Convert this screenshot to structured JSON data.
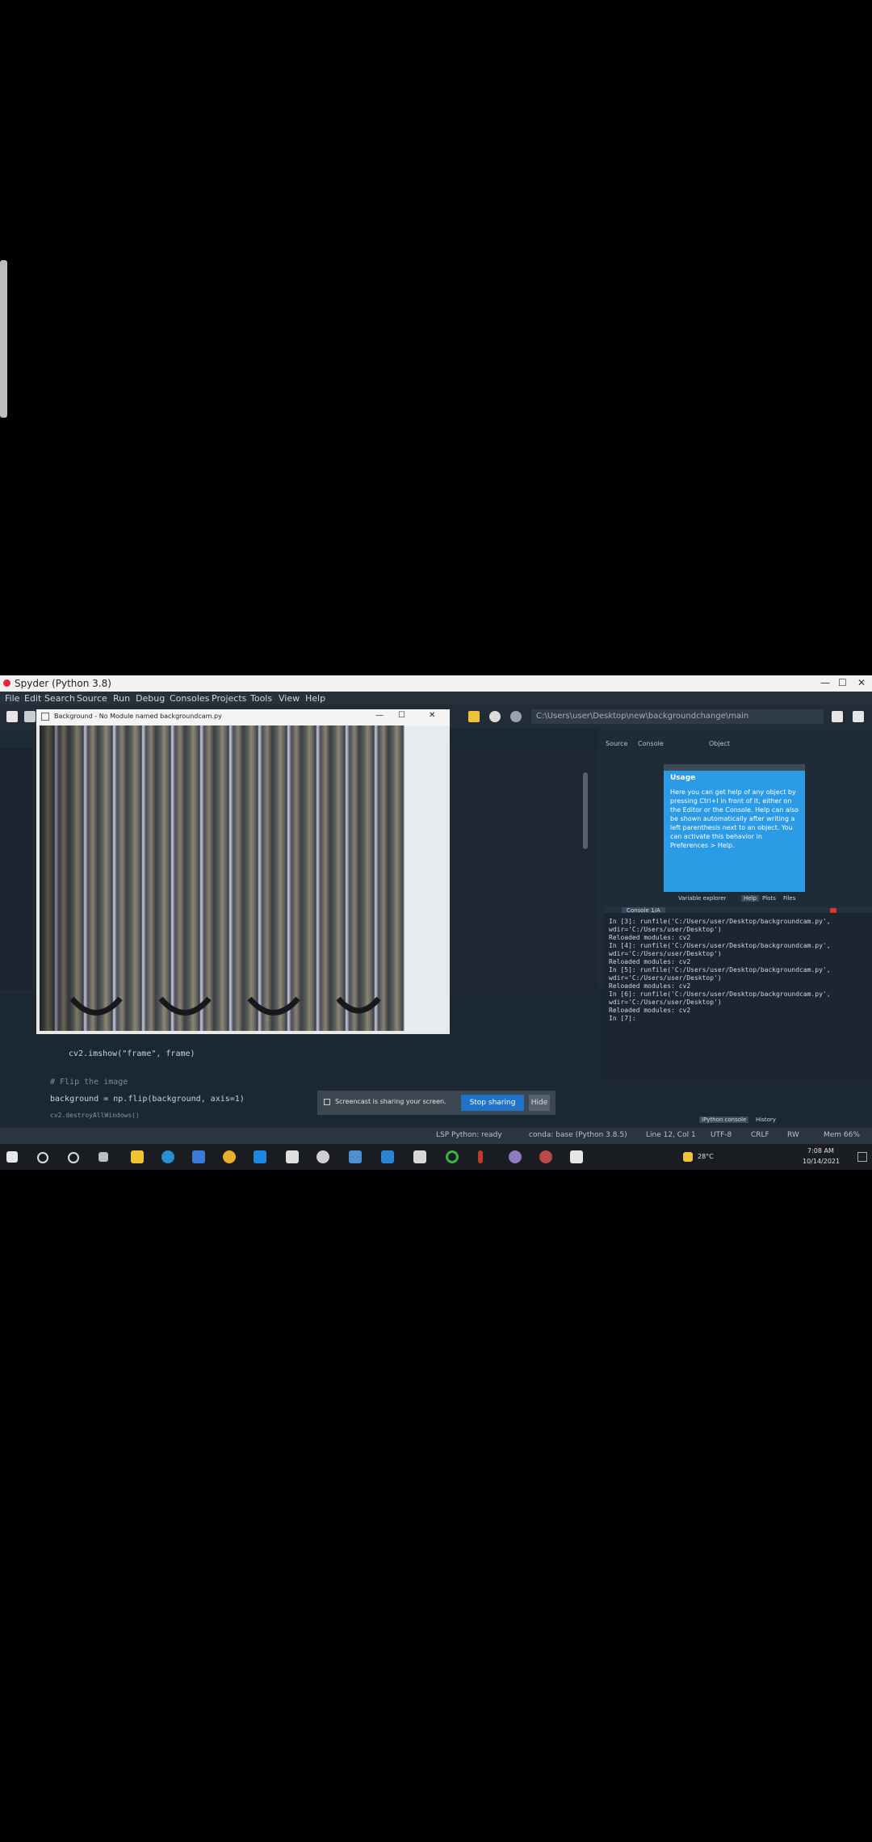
{
  "window": {
    "title": "Spyder (Python 3.8)",
    "close_glyph": "✕",
    "minimize_glyph": "—",
    "maximize_glyph": "☐"
  },
  "menu": [
    "File",
    "Edit",
    "Search",
    "Source",
    "Run",
    "Debug",
    "Consoles",
    "Projects",
    "Tools",
    "View",
    "Help"
  ],
  "toolbar": {
    "path": "C:\\Users\\user\\Desktop\\new\\backgroundchange\\main"
  },
  "editor": {
    "lines": [
      "cv2.imshow(\"frame\", frame)",
      "# Flip the image",
      "background = np.flip(background, axis=1)",
      "cv2.destroyAllWindows()"
    ]
  },
  "camera_window": {
    "title": "Background - No Module named backgroundcam.py"
  },
  "right_panel": {
    "tabs": [
      "Source",
      "Console",
      "Object"
    ],
    "help_title": "Usage",
    "help_text": "Here you can get help of any object by pressing Ctrl+I in front of it, either on the Editor or the Console. Help can also be shown automatically after writing a left parenthesis next to an object. You can activate this behavior in Preferences > Help.",
    "help_bottom_tabs": [
      "Variable explorer",
      "Help",
      "Plots",
      "Files"
    ]
  },
  "console": {
    "tab": "Console 1/A",
    "lines": [
      "In [3]: runfile('C:/Users/user/Desktop/backgroundcam.py',",
      "wdir='C:/Users/user/Desktop')",
      "Reloaded modules: cv2",
      "In [4]: runfile('C:/Users/user/Desktop/backgroundcam.py',",
      "wdir='C:/Users/user/Desktop')",
      "Reloaded modules: cv2",
      "In [5]: runfile('C:/Users/user/Desktop/backgroundcam.py',",
      "wdir='C:/Users/user/Desktop')",
      "Reloaded modules: cv2",
      "In [6]: runfile('C:/Users/user/Desktop/backgroundcam.py',",
      "wdir='C:/Users/user/Desktop')",
      "Reloaded modules: cv2",
      "In [7]:"
    ],
    "bottom_tabs": [
      "IPython console",
      "History"
    ]
  },
  "notification": {
    "text": "Screencast is sharing your screen.",
    "primary": "Stop sharing",
    "secondary": "Hide"
  },
  "statusbar": [
    "LSP Python: ready",
    "conda: base (Python 3.8.5)",
    "Line 12, Col 1",
    "UTF-8",
    "CRLF",
    "RW",
    "Mem 66%"
  ],
  "tray": {
    "temp": "28°C",
    "time": "7:08 AM",
    "date": "10/14/2021"
  }
}
